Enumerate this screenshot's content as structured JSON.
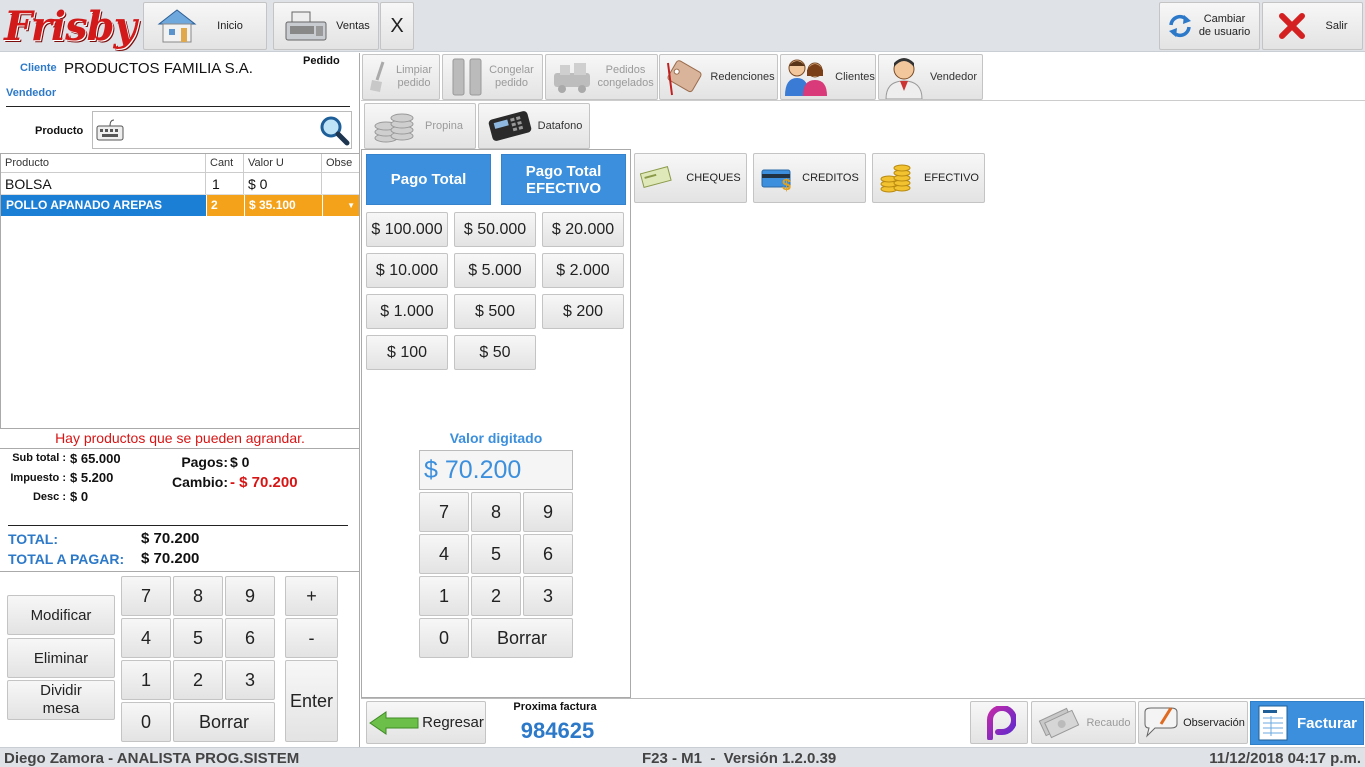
{
  "top": {
    "brand": "Frisby",
    "inicio": "Inicio",
    "ventas": "Ventas",
    "close": "X",
    "cambiar": "Cambiar de usuario",
    "salir": "Salir"
  },
  "order": {
    "cliente_label": "Cliente",
    "cliente": "PRODUCTOS FAMILIA S.A.",
    "pedido_label": "Pedido",
    "vendedor_label": "Vendedor",
    "producto_label": "Producto",
    "columns": [
      "Producto",
      "Cant",
      "Valor U",
      "Obse"
    ],
    "rows": [
      {
        "producto": "BOLSA",
        "cant": "1",
        "valor": "$ 0"
      },
      {
        "producto": "POLLO APANADO AREPAS",
        "cant": "2",
        "valor": "$ 35.100"
      }
    ],
    "warning": "Hay productos que se pueden agrandar."
  },
  "totals": {
    "subtotal_label": "Sub total :",
    "subtotal": "$ 65.000",
    "impuesto_label": "Impuesto :",
    "impuesto": "$ 5.200",
    "desc_label": "Desc :",
    "desc": "$ 0",
    "pagos_label": "Pagos:",
    "pagos": "$ 0",
    "cambio_label": "Cambio:",
    "cambio": "- $ 70.200",
    "total_label": "TOTAL:",
    "total": "$ 70.200",
    "total_pagar_label": "TOTAL A PAGAR:",
    "total_pagar": "$ 70.200"
  },
  "leftpad": {
    "modificar": "Modificar",
    "eliminar": "Eliminar",
    "dividir": "Dividir mesa",
    "keys": [
      "7",
      "8",
      "9",
      "4",
      "5",
      "6",
      "1",
      "2",
      "3",
      "0"
    ],
    "borrar": "Borrar",
    "plus": "+",
    "minus": "-",
    "enter": "Enter"
  },
  "tools": {
    "limpiar": "Limpiar pedido",
    "congelar": "Congelar pedido",
    "congelados": "Pedidos congelados",
    "redenciones": "Redenciones",
    "clientes": "Clientes",
    "vendedor": "Vendedor",
    "propina": "Propina",
    "datafono": "Datafono"
  },
  "pay": {
    "pago_total": "Pago Total",
    "pago_efectivo": "Pago Total EFECTIVO",
    "denoms": [
      "$ 100.000",
      "$ 50.000",
      "$ 20.000",
      "$ 10.000",
      "$ 5.000",
      "$ 2.000",
      "$ 1.000",
      "$ 500",
      "$ 200",
      "$ 100",
      "$ 50"
    ],
    "valor_label": "Valor digitado",
    "valor": "$ 70.200",
    "keys": [
      "7",
      "8",
      "9",
      "4",
      "5",
      "6",
      "1",
      "2",
      "3",
      "0"
    ],
    "borrar": "Borrar"
  },
  "methods": {
    "cheques": "CHEQUES",
    "creditos": "CREDITOS",
    "efectivo": "EFECTIVO"
  },
  "bottom": {
    "regresar": "Regresar",
    "proxima_label": "Proxima factura",
    "proxima": "984625",
    "recaudo": "Recaudo",
    "observacion": "Observación",
    "facturar": "Facturar"
  },
  "status": {
    "user": "Diego Zamora - ANALISTA PROG.SISTEM",
    "version": "F23 - M1  -  Versión 1.2.0.39",
    "datetime": "11/12/2018 04:17 p.m."
  },
  "colors": {
    "accent": "#3c8fdc",
    "selected_row": "#1c7fd6",
    "highlight": "#f5a21b",
    "warning": "#d81515"
  }
}
